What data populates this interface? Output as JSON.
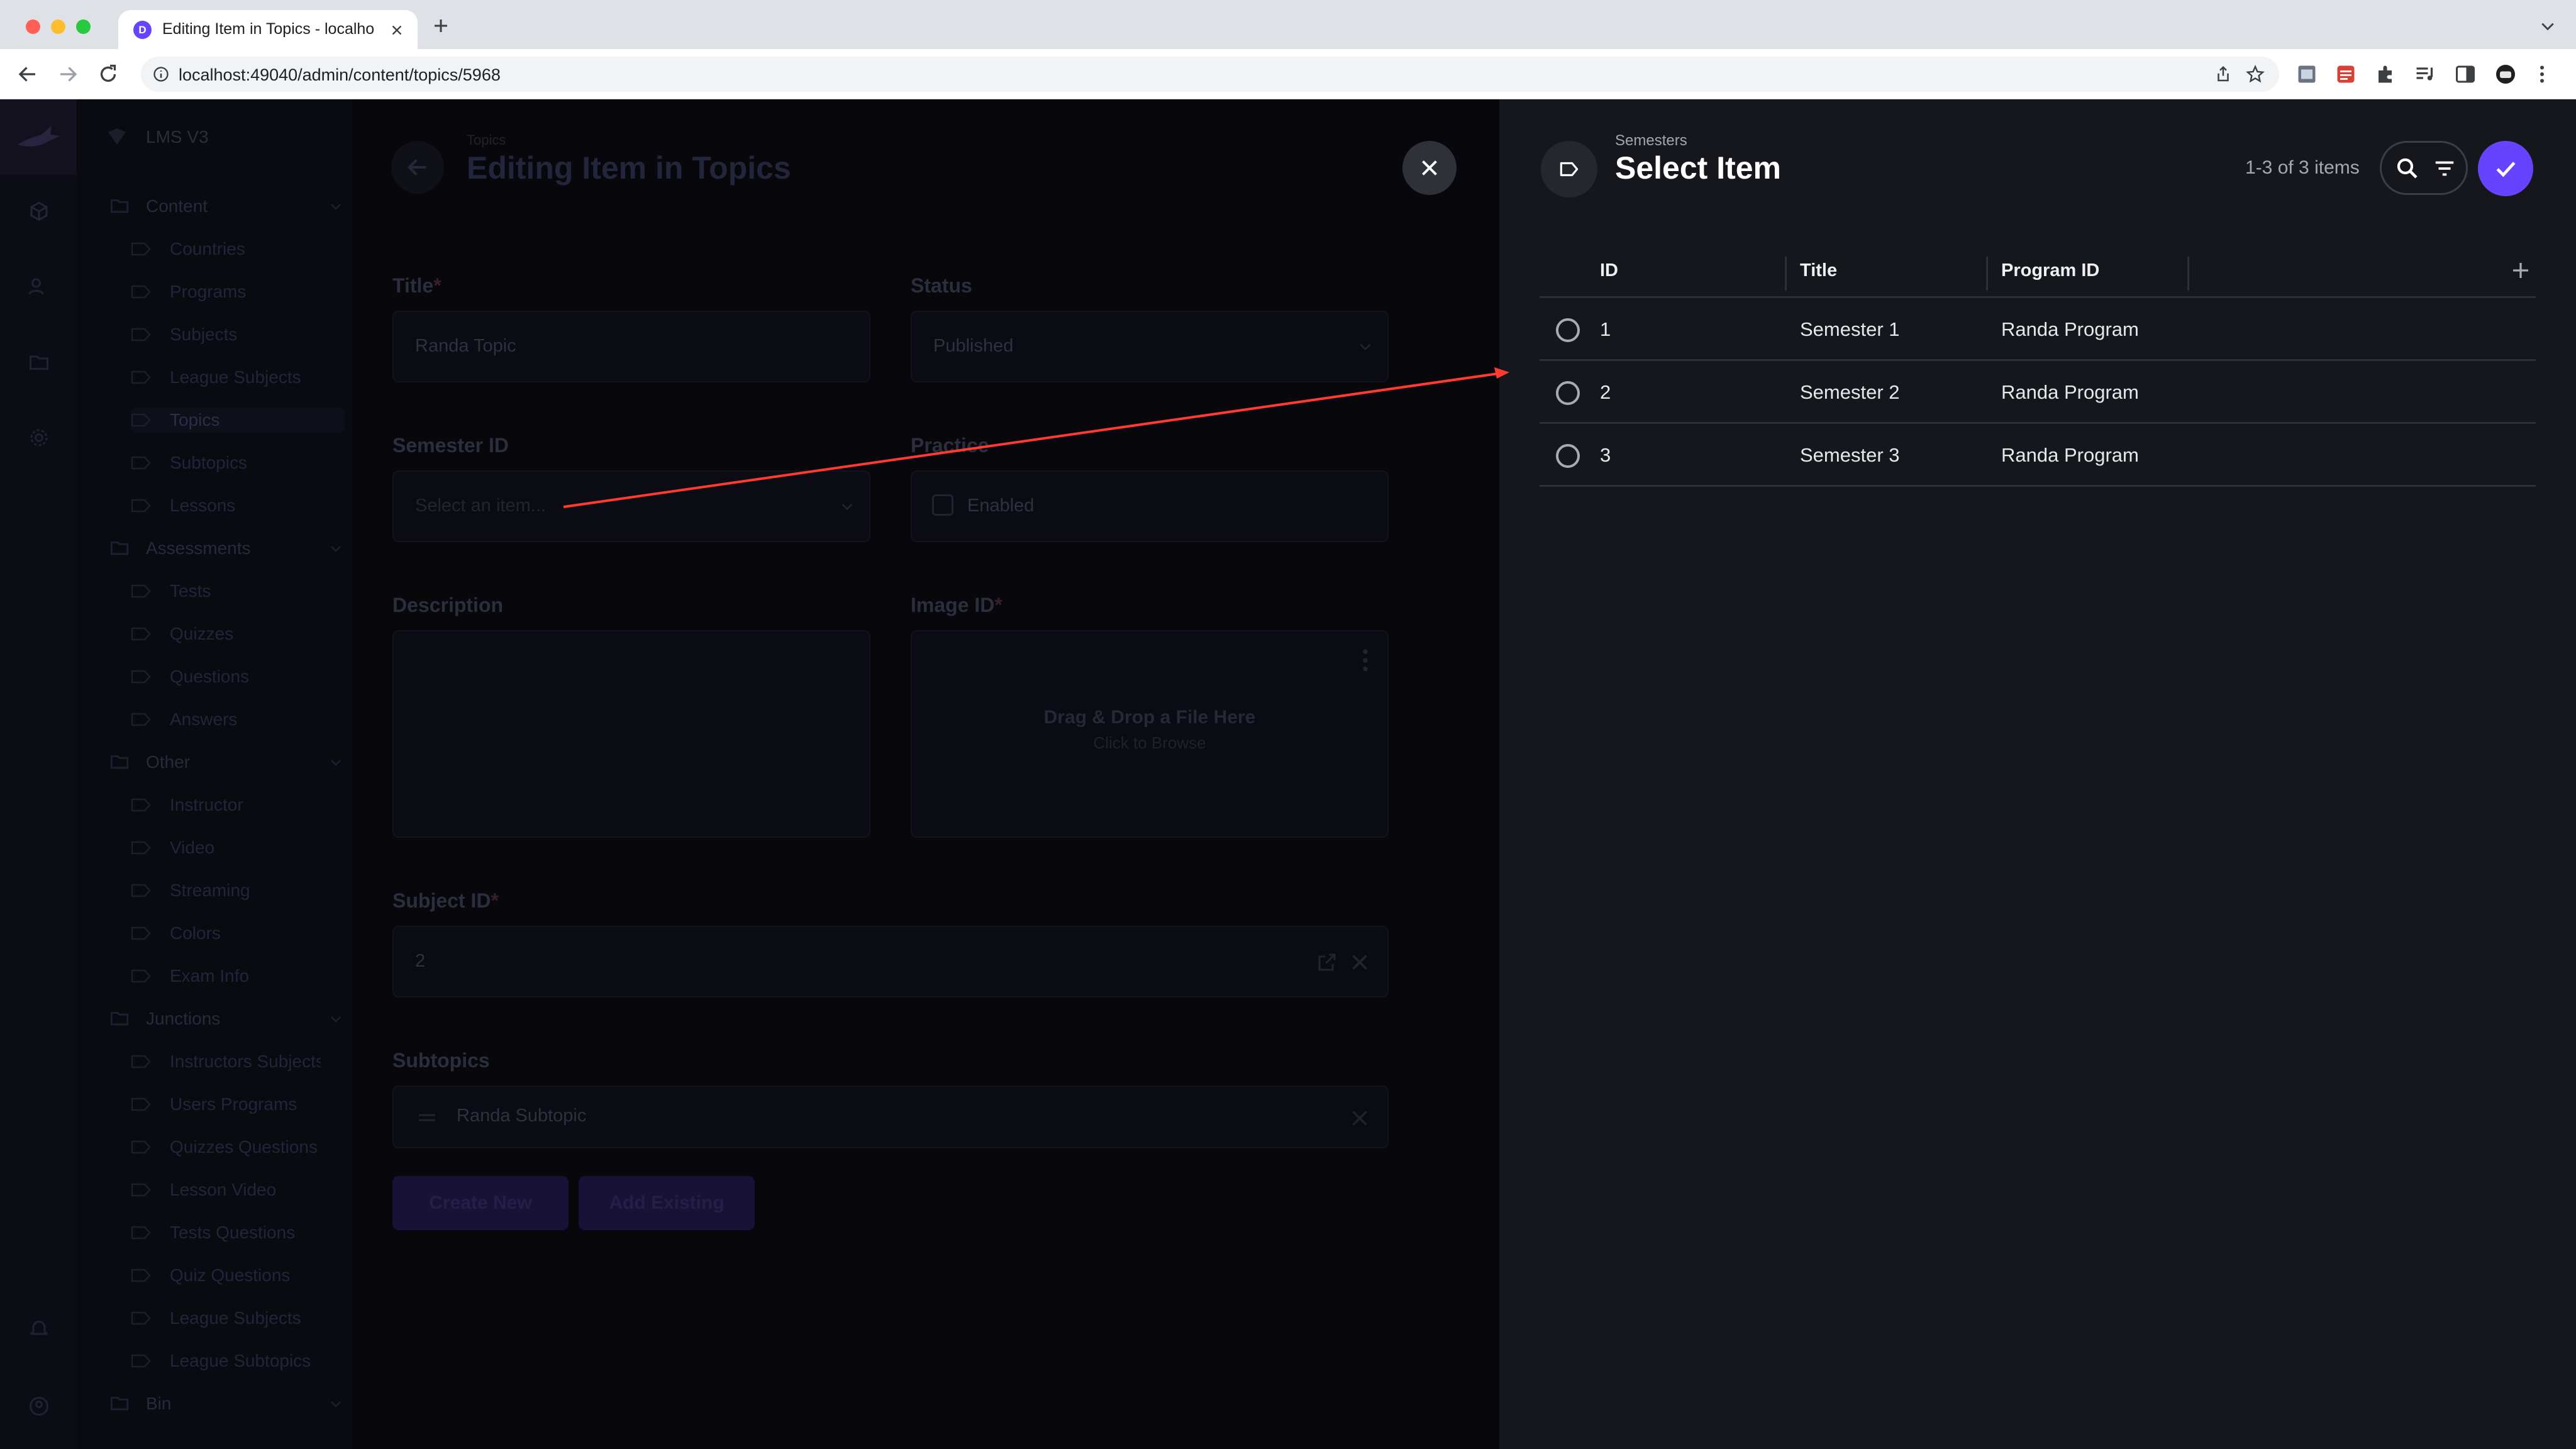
{
  "browser": {
    "tab_title": "Editing Item in Topics - localho",
    "url": "localhost:49040/admin/content/topics/5968"
  },
  "app": {
    "project_name": "LMS V3",
    "breadcrumb": "Topics",
    "page_title": "Editing Item in Topics",
    "nav": [
      {
        "type": "group",
        "label": "Content"
      },
      {
        "type": "item",
        "label": "Countries"
      },
      {
        "type": "item",
        "label": "Programs"
      },
      {
        "type": "item",
        "label": "Subjects"
      },
      {
        "type": "item",
        "label": "League Subjects"
      },
      {
        "type": "item",
        "label": "Topics",
        "active": true
      },
      {
        "type": "item",
        "label": "Subtopics"
      },
      {
        "type": "item",
        "label": "Lessons"
      },
      {
        "type": "group",
        "label": "Assessments"
      },
      {
        "type": "item",
        "label": "Tests"
      },
      {
        "type": "item",
        "label": "Quizzes"
      },
      {
        "type": "item",
        "label": "Questions"
      },
      {
        "type": "item",
        "label": "Answers"
      },
      {
        "type": "group",
        "label": "Other"
      },
      {
        "type": "item",
        "label": "Instructor"
      },
      {
        "type": "item",
        "label": "Video"
      },
      {
        "type": "item",
        "label": "Streaming"
      },
      {
        "type": "item",
        "label": "Colors"
      },
      {
        "type": "item",
        "label": "Exam Info"
      },
      {
        "type": "group",
        "label": "Junctions"
      },
      {
        "type": "item",
        "label": "Instructors Subjects"
      },
      {
        "type": "item",
        "label": "Users Programs"
      },
      {
        "type": "item",
        "label": "Quizzes Questions"
      },
      {
        "type": "item",
        "label": "Lesson Video"
      },
      {
        "type": "item",
        "label": "Tests Questions"
      },
      {
        "type": "item",
        "label": "Quiz Questions"
      },
      {
        "type": "item",
        "label": "League Subjects"
      },
      {
        "type": "item",
        "label": "League Subtopics"
      },
      {
        "type": "group",
        "label": "Bin"
      }
    ],
    "form": {
      "title_label": "Title",
      "title_value": "Randa Topic",
      "status_label": "Status",
      "status_value": "Published",
      "semester_label": "Semester ID",
      "semester_placeholder": "Select an item...",
      "practice_label": "Practice",
      "practice_value": "Enabled",
      "description_label": "Description",
      "image_label": "Image ID",
      "upload_main": "Drag & Drop a File Here",
      "upload_sub": "Click to Browse",
      "subject_label": "Subject ID",
      "subject_value": "2",
      "subtopics_label": "Subtopics",
      "subtopic_item": "Randa Subtopic",
      "create_new": "Create New",
      "add_existing": "Add Existing",
      "required_mark": "*"
    }
  },
  "drawer": {
    "collection": "Semesters",
    "title": "Select Item",
    "count": "1-3 of 3 items",
    "columns": [
      "ID",
      "Title",
      "Program ID"
    ],
    "rows": [
      {
        "id": "1",
        "title": "Semester 1",
        "program": "Randa Program"
      },
      {
        "id": "2",
        "title": "Semester 2",
        "program": "Randa Program"
      },
      {
        "id": "3",
        "title": "Semester 3",
        "program": "Randa Program"
      }
    ]
  },
  "colors": {
    "accent": "#6644ff",
    "annotation_arrow": "#ff3b30",
    "drawer_bg": "#16171c"
  }
}
